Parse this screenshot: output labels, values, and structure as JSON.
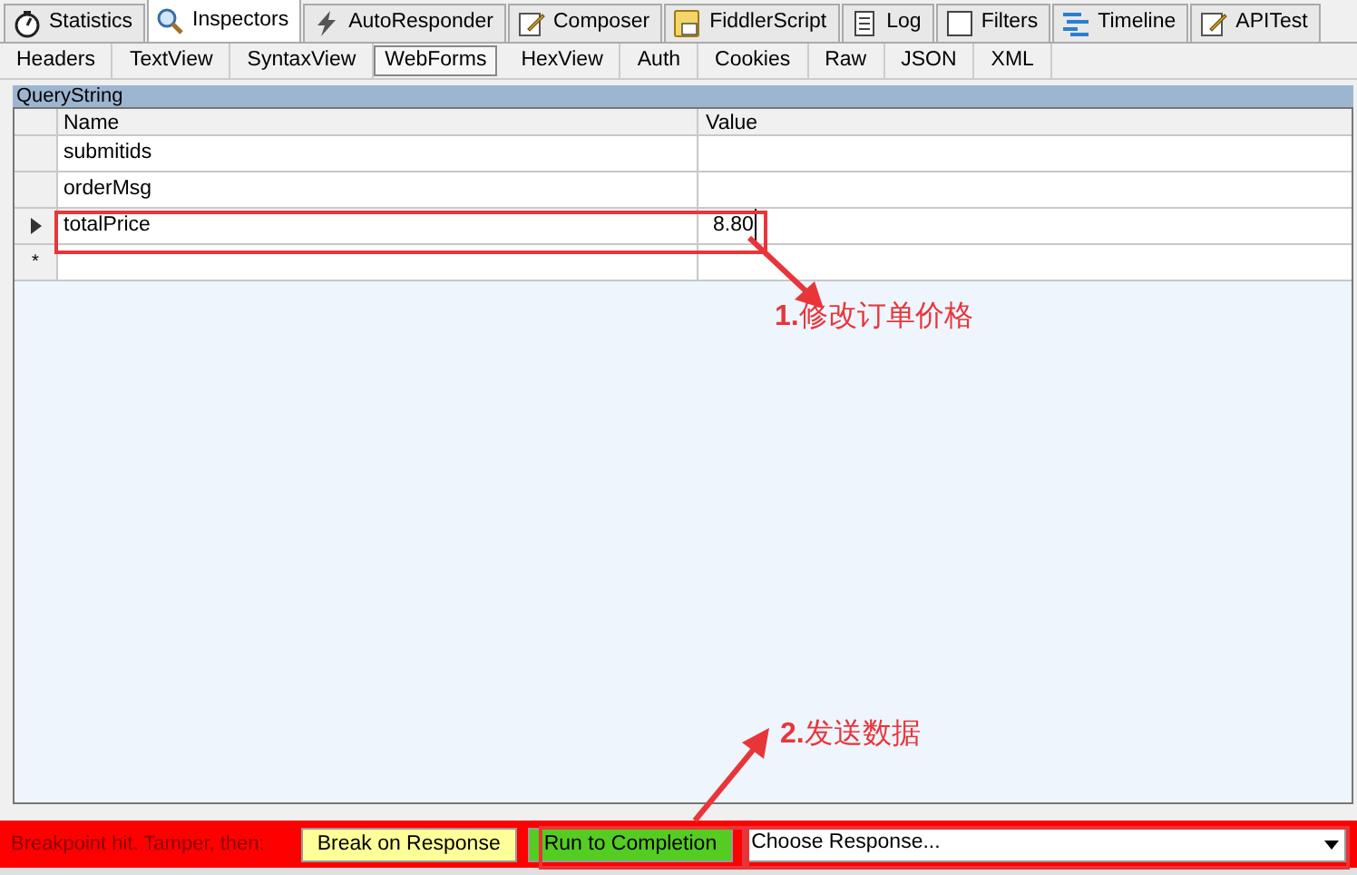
{
  "tabs": [
    {
      "label": "Statistics",
      "selected": false
    },
    {
      "label": "Inspectors",
      "selected": true
    },
    {
      "label": "AutoResponder",
      "selected": false
    },
    {
      "label": "Composer",
      "selected": false
    },
    {
      "label": "FiddlerScript",
      "selected": false
    },
    {
      "label": "Log",
      "selected": false
    },
    {
      "label": "Filters",
      "selected": false
    },
    {
      "label": "Timeline",
      "selected": false
    },
    {
      "label": "APITest",
      "selected": false
    }
  ],
  "subtabs": [
    {
      "label": "Headers",
      "selected": false
    },
    {
      "label": "TextView",
      "selected": false
    },
    {
      "label": "SyntaxView",
      "selected": false
    },
    {
      "label": "WebForms",
      "selected": true
    },
    {
      "label": "HexView",
      "selected": false
    },
    {
      "label": "Auth",
      "selected": false
    },
    {
      "label": "Cookies",
      "selected": false
    },
    {
      "label": "Raw",
      "selected": false
    },
    {
      "label": "JSON",
      "selected": false
    },
    {
      "label": "XML",
      "selected": false
    }
  ],
  "section_title": "QueryString",
  "grid": {
    "columns": [
      "Name",
      "Value"
    ],
    "rows": [
      {
        "name": "submitids",
        "current": false
      },
      {
        "name": "orderMsg",
        "current": false
      },
      {
        "name": "totalPrice",
        "value": "8.80",
        "current": true
      }
    ],
    "new_row_marker": "*"
  },
  "annotations": [
    {
      "text": "**1.**修改订单价格"
    },
    {
      "text": "**2.**发送数据"
    }
  ],
  "breakpoint_bar": {
    "message": "Breakpoint hit. Tamper, then:",
    "buttons": [
      {
        "label": "Break on Response",
        "color": "#ffff99"
      },
      {
        "label": "Run to Completion",
        "color": "#55cc22"
      }
    ],
    "dropdown": {
      "value": "Choose Response..."
    }
  }
}
